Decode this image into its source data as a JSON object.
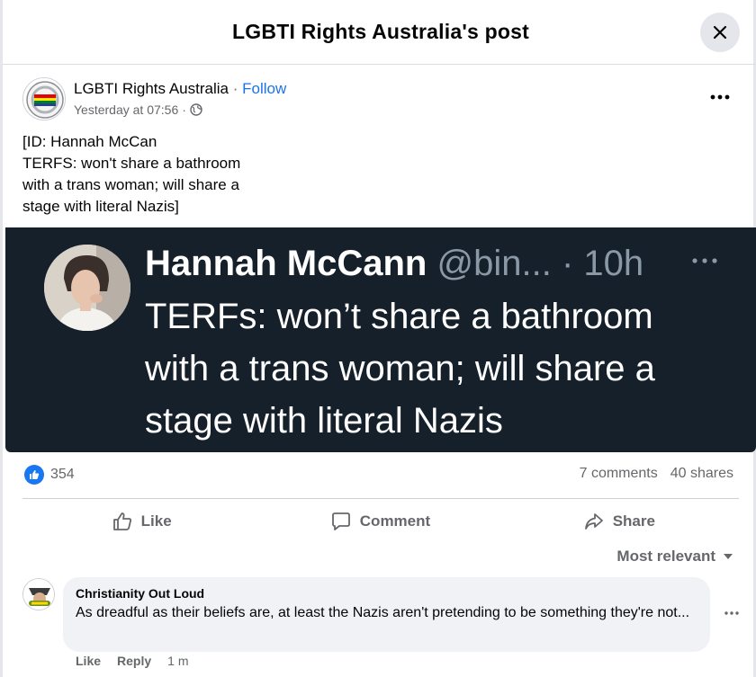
{
  "header": {
    "title": "LGBTI Rights Australia's post",
    "close_icon": "close-icon"
  },
  "post": {
    "page_name": "LGBTI Rights Australia",
    "separator": "·",
    "follow_label": "Follow",
    "timestamp": "Yesterday at 07:56",
    "meta_separator": "·",
    "audience_icon": "globe-icon",
    "caption_lines": [
      "[ID: Hannah McCan",
      "TERFS: won't share a bathroom",
      "with a trans woman; will share a",
      "stage with literal Nazis]"
    ]
  },
  "tweet": {
    "name": "Hannah McCann",
    "handle": "@bin...",
    "time": "· 10h",
    "text_lines": [
      "TERFs: won’t share a bathroom",
      "with a trans woman; will share a",
      "stage with literal Nazis"
    ],
    "colors": {
      "background": "#15202b",
      "text": "#ffffff",
      "muted": "#8b98a5"
    }
  },
  "engagement": {
    "reaction_count": "354",
    "comments": "7 comments",
    "shares": "40 shares"
  },
  "actions": {
    "like": "Like",
    "comment": "Comment",
    "share": "Share"
  },
  "sort_label": "Most relevant",
  "comment": {
    "author": "Christianity Out Loud",
    "text": "As dreadful as their beliefs are, at least the Nazis aren't pretending to be something they're not...",
    "like": "Like",
    "reply": "Reply",
    "time": "1 m"
  },
  "colors": {
    "accent": "#1877f2",
    "link": "#1b74e4",
    "muted_text": "#65676b",
    "bubble": "#f0f2f5"
  }
}
